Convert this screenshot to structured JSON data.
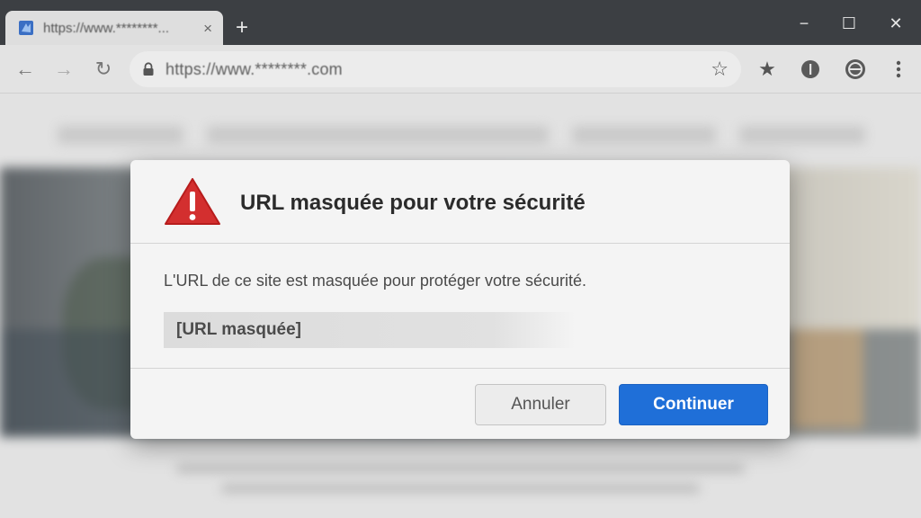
{
  "browser": {
    "tab": {
      "title": "https://www.********...",
      "close_icon": "×"
    },
    "new_tab_icon": "+",
    "window_controls": {
      "minimize": "−",
      "maximize": "☐",
      "close": "✕"
    },
    "nav": {
      "back": "←",
      "forward": "→",
      "reload": "↻"
    },
    "address": {
      "url": "https://www.********.com"
    },
    "toolbar_icons": [
      "star-outline-icon",
      "bookmark-star-icon",
      "shield-icon",
      "profile-icon",
      "menu-icon"
    ]
  },
  "dialog": {
    "title": "URL masquée pour votre sécurité",
    "message": "L'URL de ce site est masquée pour protéger votre sécurité.",
    "masked_url": "[URL masquée]",
    "cancel_label": "Annuler",
    "continue_label": "Continuer",
    "warning_color": "#d32f2f",
    "accent_color": "#1f6fd8"
  }
}
